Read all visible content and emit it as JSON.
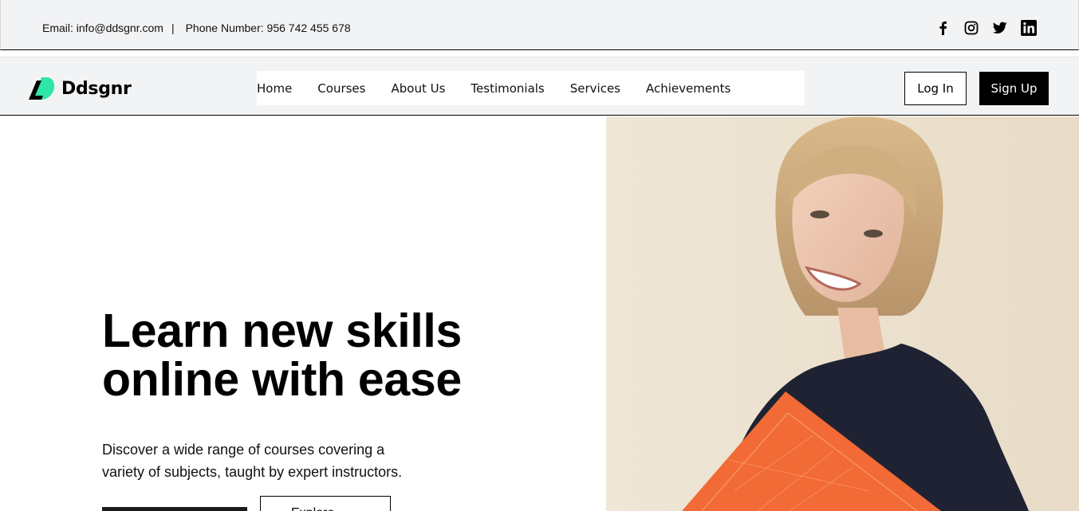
{
  "topbar": {
    "email": "Email: info@ddsgnr.com",
    "separator": "|",
    "phone": "Phone Number: 956 742 455 678",
    "socials": [
      "facebook-icon",
      "instagram-icon",
      "twitter-icon",
      "linkedin-icon"
    ]
  },
  "brand": {
    "name": "Ddsgnr",
    "accent": "#2ee6a6"
  },
  "nav": {
    "items": [
      "Home",
      "Courses",
      "About Us",
      "Testimonials",
      "Services",
      "Achievements"
    ]
  },
  "auth": {
    "login": "Log In",
    "signup": "Sign Up"
  },
  "hero": {
    "title_line1": "Learn new skills",
    "title_line2": "online with ease",
    "description": "Discover a wide range of courses covering a variety of subjects, taught by expert instructors.",
    "secondary_cta": "Explore",
    "image_alt": "smiling-woman-holding-orange-folder"
  },
  "colors": {
    "bar_bg": "#f2f3f5",
    "button_dark": "#000000",
    "photo_bg": "#ede3d2",
    "folder": "#f26a35"
  }
}
